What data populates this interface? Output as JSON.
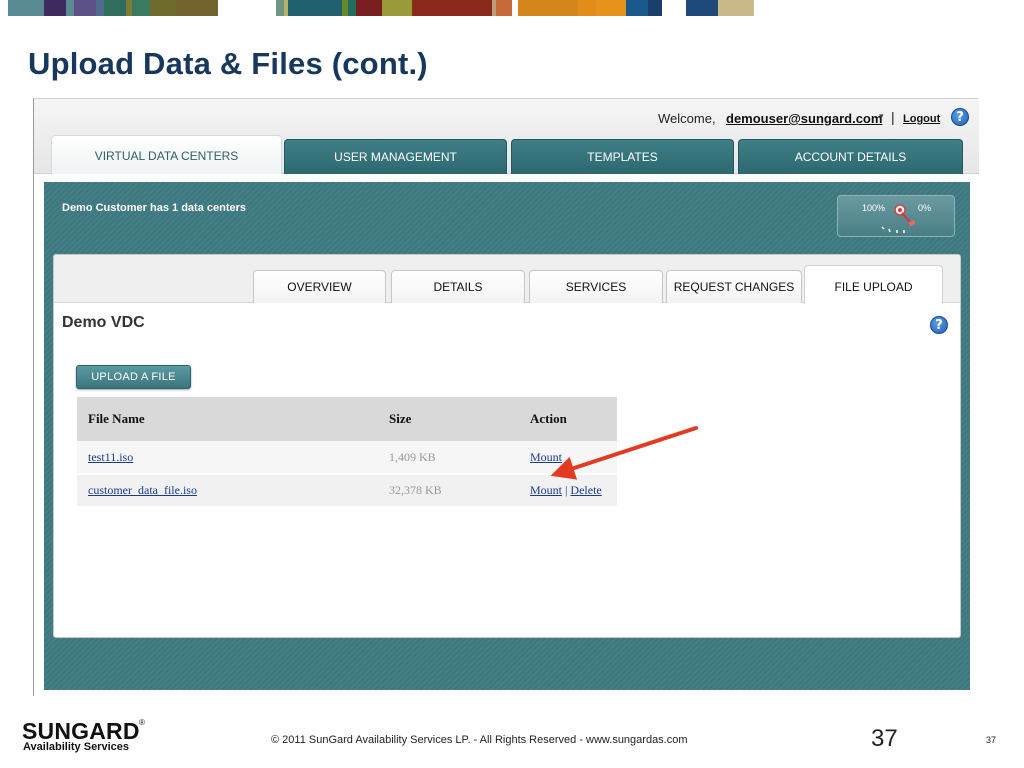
{
  "strip_colors": [
    "#ffffff",
    "#5a8a94",
    "#3d2a5e",
    "#5a8a94",
    "#5d5287",
    "#4f6b8f",
    "#2f6e5e",
    "#7c7d33",
    "#3b7a5f",
    "#6e6a2e",
    "#73642e",
    "#ffffff",
    "#6f9682",
    "#b8b06a",
    "#1f5f6e",
    "#6a8a2a",
    "#1f6e5e",
    "#7a1f1f",
    "#9a9a3a",
    "#8a2a1a",
    "#b8a07a",
    "#c76a3a",
    "#ffffff",
    "#d4861a",
    "#e38c1a",
    "#e7921a",
    "#1a5a8a",
    "#183e6e",
    "#ffffff",
    "#1e4a7a",
    "#c9b988"
  ],
  "slide": {
    "title": "Upload Data & Files (cont.)"
  },
  "header": {
    "welcome": "Welcome,",
    "user": "demouser@sungard.com",
    "caret": "▾",
    "separator": "|",
    "logout": "Logout",
    "help": "?"
  },
  "main_tabs": [
    {
      "label": "VIRTUAL DATA CENTERS",
      "active": true
    },
    {
      "label": "USER MANAGEMENT",
      "active": false
    },
    {
      "label": "TEMPLATES",
      "active": false
    },
    {
      "label": "ACCOUNT DETAILS",
      "active": false
    }
  ],
  "panel": {
    "title": "Demo Customer has 1 data centers",
    "gauge_left": "100%",
    "gauge_right": "0%"
  },
  "sub_tabs": [
    {
      "label": "OVERVIEW",
      "active": false
    },
    {
      "label": "DETAILS",
      "active": false
    },
    {
      "label": "SERVICES",
      "active": false
    },
    {
      "label": "REQUEST CHANGES",
      "active": false
    },
    {
      "label": "FILE UPLOAD",
      "active": true
    }
  ],
  "content": {
    "title": "Demo VDC",
    "help": "?",
    "upload_button": "UPLOAD A FILE"
  },
  "file_table": {
    "columns": [
      "File Name",
      "Size",
      "Action"
    ],
    "rows": [
      {
        "name": "test11.iso",
        "size": "1,409 KB",
        "actions": [
          "Mount"
        ]
      },
      {
        "name": "customer_data_file.iso",
        "size": "32,378 KB",
        "actions": [
          "Mount",
          "Delete"
        ],
        "separator": "|"
      }
    ]
  },
  "footer": {
    "logo_main": "SUNGARD",
    "logo_reg": "®",
    "logo_sub": "Availability Services",
    "copyright": "© 2011 SunGard Availability Services LP. - All Rights Reserved - www.sungardas.com",
    "page_big": "37",
    "page_small": "37"
  }
}
